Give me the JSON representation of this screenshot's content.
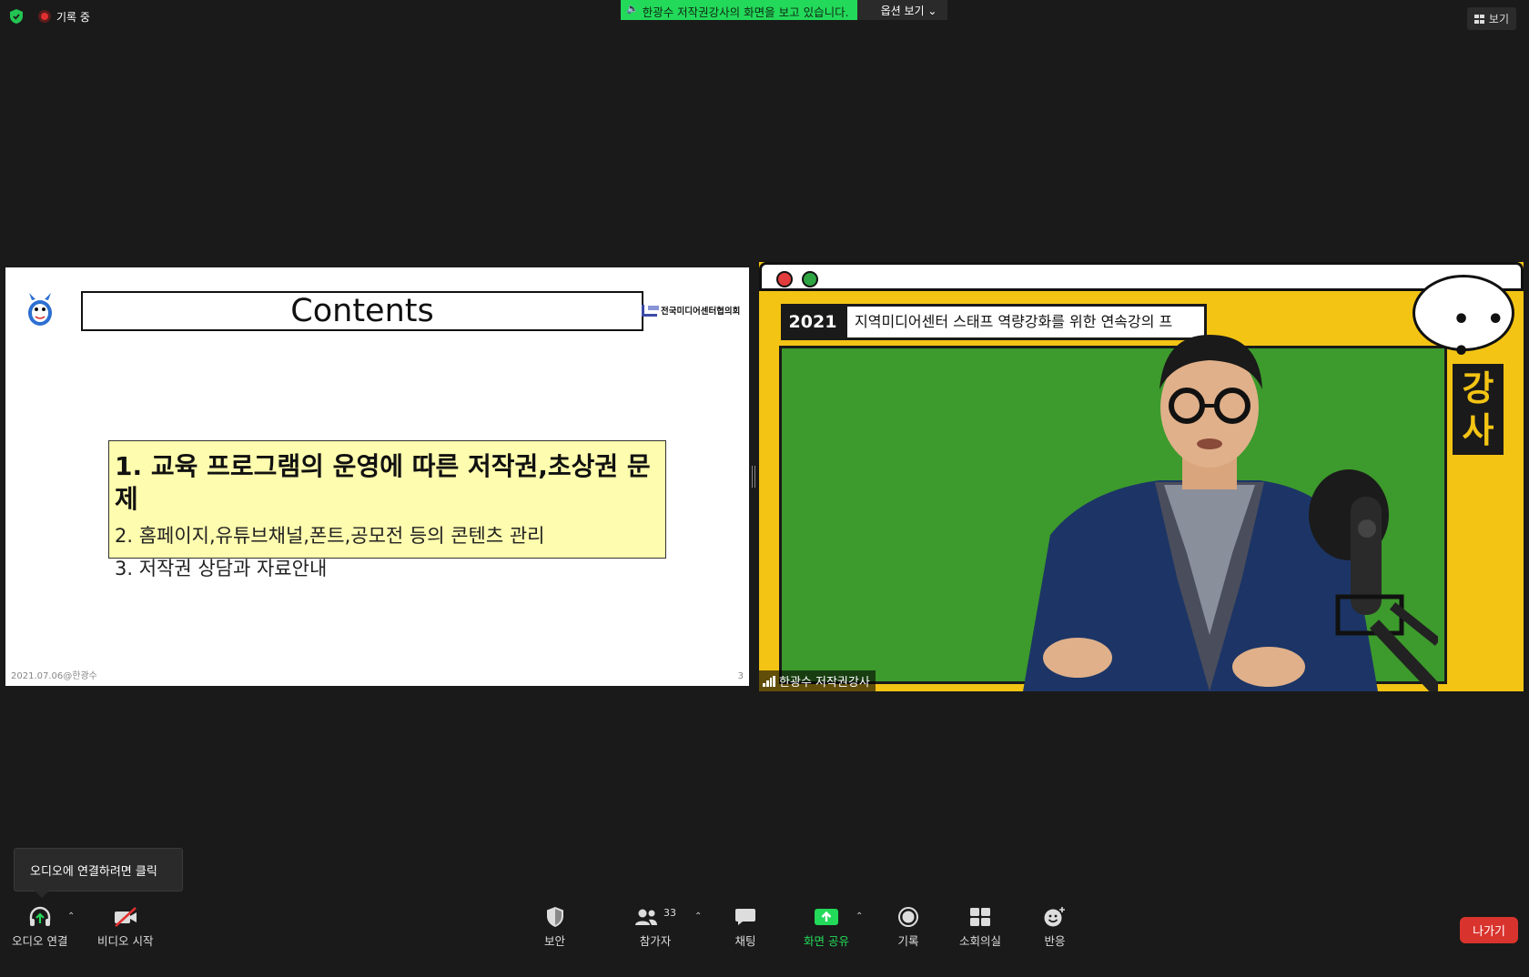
{
  "topbar": {
    "recording_label": "기록 중",
    "share_banner": "한광수 저작권강사의 화면을 보고 있습니다.",
    "view_options": "옵션 보기 ⌄",
    "view_button": "보기"
  },
  "slide": {
    "title": "Contents",
    "org_name": "전국미디어센터협의회",
    "items": [
      "1. 교육 프로그램의 운영에 따른 저작권,초상권 문제",
      "2. 홈페이지,유튜브채널,폰트,공모전 등의 콘텐츠 관리",
      "3. 저작권 상담과 자료안내"
    ],
    "footer_left": "2021.07.06@한광수",
    "page_number": "3"
  },
  "video": {
    "year_tag": "2021",
    "course_title": "지역미디어센터 스태프 역량강화를 위한 연속강의 프",
    "side_label": "강사",
    "bubble_text": "• • •",
    "participant_name": "한광수 저작권강사"
  },
  "tooltip": {
    "text": "오디오에 연결하려면 클릭"
  },
  "toolbar": {
    "audio": "오디오 연결",
    "video": "비디오 시작",
    "security": "보안",
    "participants": "참가자",
    "participants_count": "33",
    "chat": "채팅",
    "share": "화면 공유",
    "record": "기록",
    "breakout": "소회의실",
    "reactions": "반응",
    "leave": "나가기"
  },
  "colors": {
    "accent_green": "#23d959",
    "leave_red": "#d9332e",
    "slide_yellow": "#fefcae"
  }
}
